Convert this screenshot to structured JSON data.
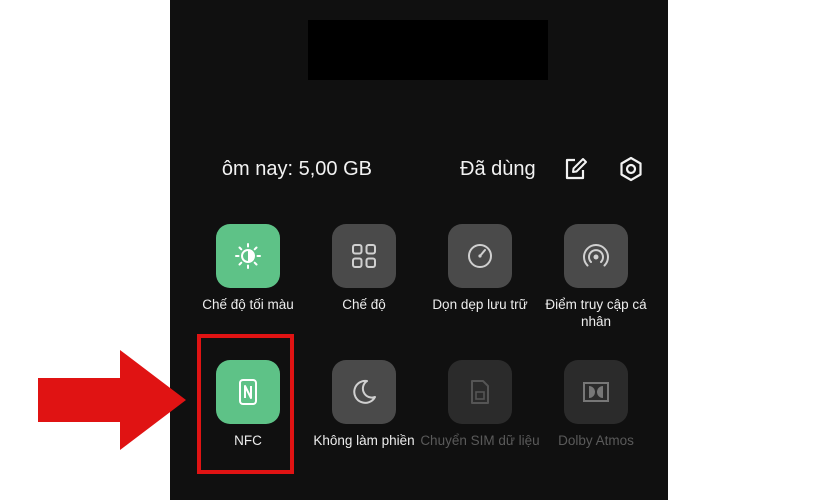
{
  "header": {
    "data_today": "ôm nay: 5,00 GB",
    "data_used": "Đã dùng",
    "edit_icon": "edit-icon",
    "settings_icon": "settings-icon"
  },
  "tiles": [
    {
      "label": "Chế độ tối màu",
      "icon": "dark-mode-icon",
      "state": "on"
    },
    {
      "label": "Chế độ",
      "icon": "grid-icon",
      "state": "off"
    },
    {
      "label": "Dọn dẹp lưu trữ",
      "icon": "gauge-icon",
      "state": "off"
    },
    {
      "label": "Điểm truy cập cá nhân",
      "icon": "hotspot-icon",
      "state": "off"
    },
    {
      "label": "NFC",
      "icon": "nfc-icon",
      "state": "on"
    },
    {
      "label": "Không làm phiền",
      "icon": "moon-icon",
      "state": "off"
    },
    {
      "label": "Chuyển SIM dữ liệu",
      "icon": "sim-icon",
      "state": "disabled"
    },
    {
      "label": "Dolby Atmos",
      "icon": "dolby-icon",
      "state": "disabled"
    }
  ],
  "colors": {
    "panel_bg": "#101010",
    "tile_on": "#5ec287",
    "tile_off": "#4a4a4a",
    "tile_disabled": "#2b2b2b",
    "highlight": "#e01313"
  }
}
